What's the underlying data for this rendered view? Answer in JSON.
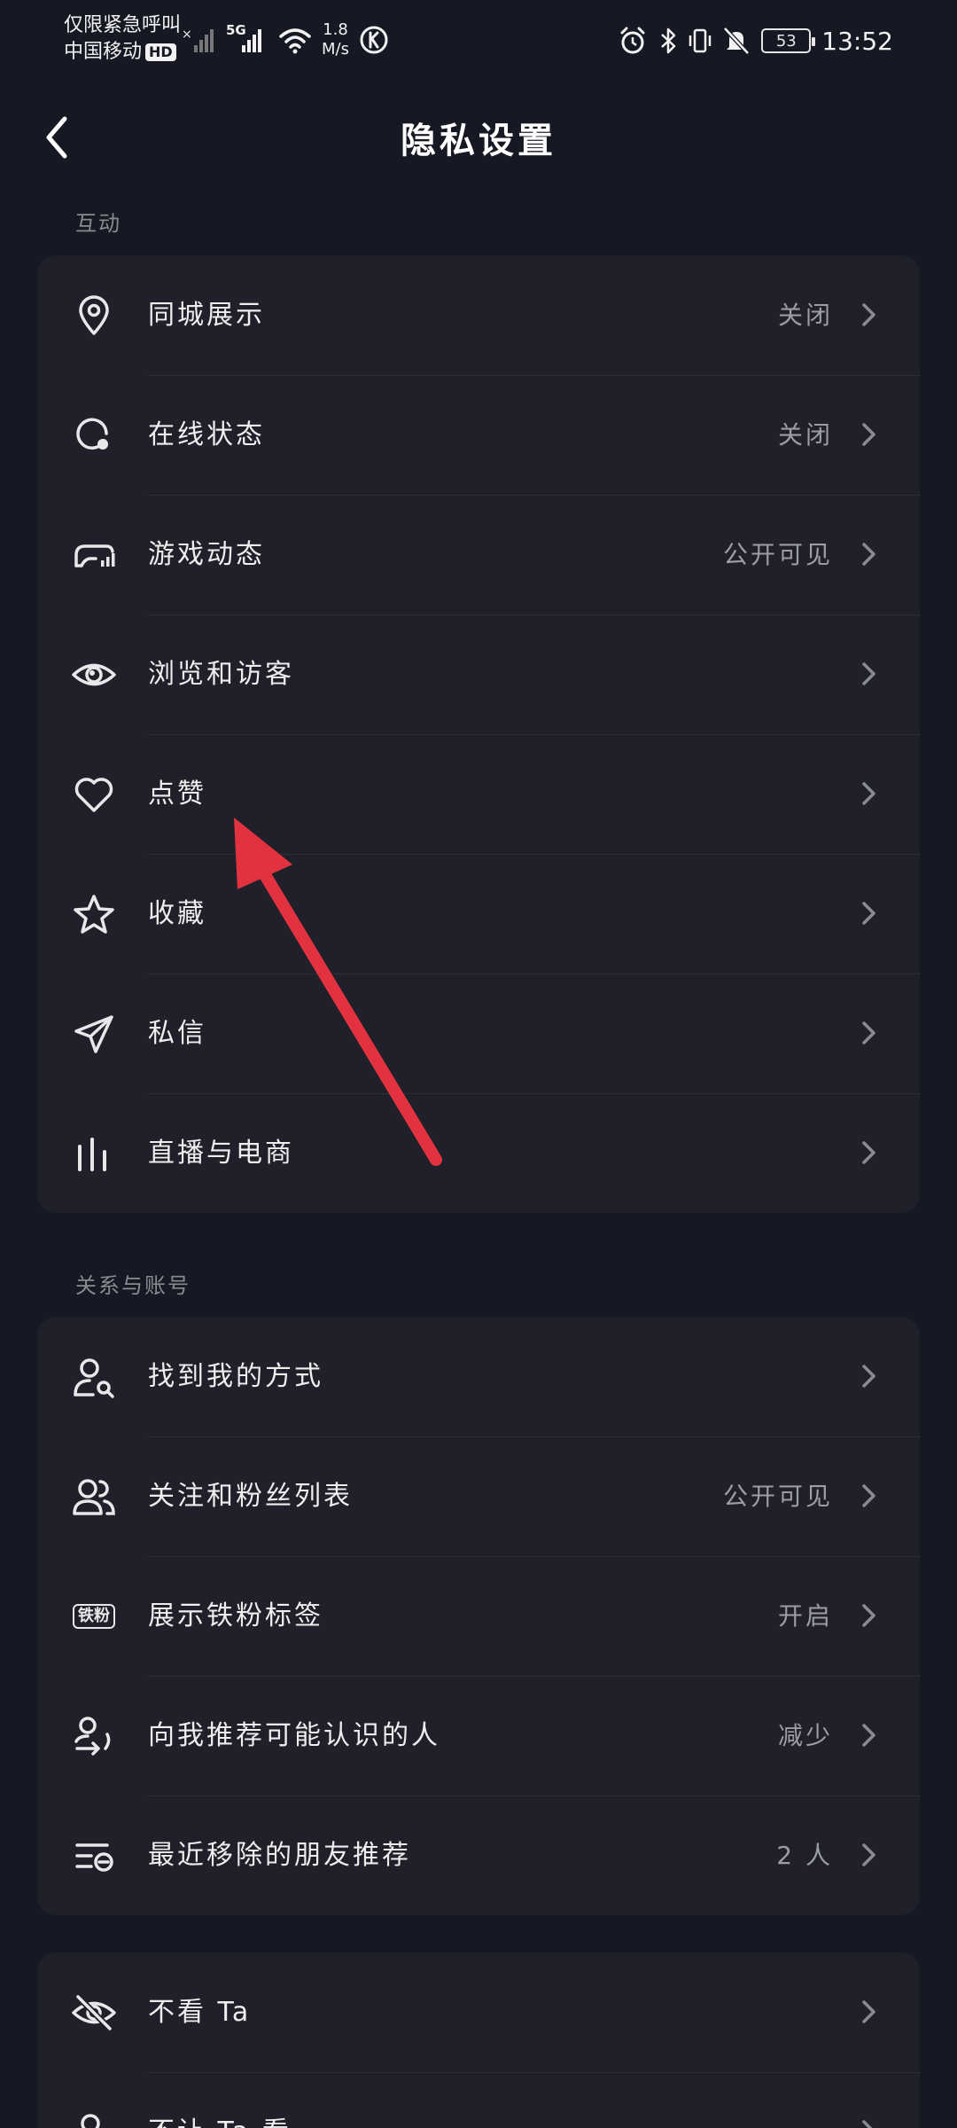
{
  "status_bar": {
    "emergency_text": "仅限紧急呼叫",
    "carrier": "中国移动",
    "hd_label": "HD",
    "network_label": "5G",
    "speed_value": "1.8",
    "speed_unit": "M/s",
    "battery": "53",
    "time": "13:52"
  },
  "header": {
    "title": "隐私设置"
  },
  "section_interaction": {
    "label": "互动",
    "items": [
      {
        "label": "同城展示",
        "value": "关闭",
        "icon": "location-pin-icon"
      },
      {
        "label": "在线状态",
        "value": "关闭",
        "icon": "online-status-icon"
      },
      {
        "label": "游戏动态",
        "value": "公开可见",
        "icon": "game-controller-icon"
      },
      {
        "label": "浏览和访客",
        "value": "",
        "icon": "eye-icon"
      },
      {
        "label": "点赞",
        "value": "",
        "icon": "heart-icon"
      },
      {
        "label": "收藏",
        "value": "",
        "icon": "star-icon"
      },
      {
        "label": "私信",
        "value": "",
        "icon": "paper-plane-icon"
      },
      {
        "label": "直播与电商",
        "value": "",
        "icon": "bar-chart-icon"
      }
    ]
  },
  "section_relations": {
    "label": "关系与账号",
    "items": [
      {
        "label": "找到我的方式",
        "value": "",
        "icon": "user-search-icon"
      },
      {
        "label": "关注和粉丝列表",
        "value": "公开可见",
        "icon": "users-icon"
      },
      {
        "label": "展示铁粉标签",
        "value": "开启",
        "icon": "tiefen-badge-icon",
        "badge_text": "铁粉"
      },
      {
        "label": "向我推荐可能认识的人",
        "value": "减少",
        "icon": "recommend-user-icon"
      },
      {
        "label": "最近移除的朋友推荐",
        "value": "2 人",
        "icon": "removed-list-icon"
      }
    ]
  },
  "section_block": {
    "items": [
      {
        "label": "不看 Ta",
        "value": "",
        "icon": "eye-off-icon"
      },
      {
        "label": "不让 Ta 看",
        "value": "",
        "icon": "user-block-icon"
      }
    ]
  },
  "colors": {
    "background": "#161823",
    "card": "#1f2029",
    "annotation_arrow": "#e3323f"
  }
}
